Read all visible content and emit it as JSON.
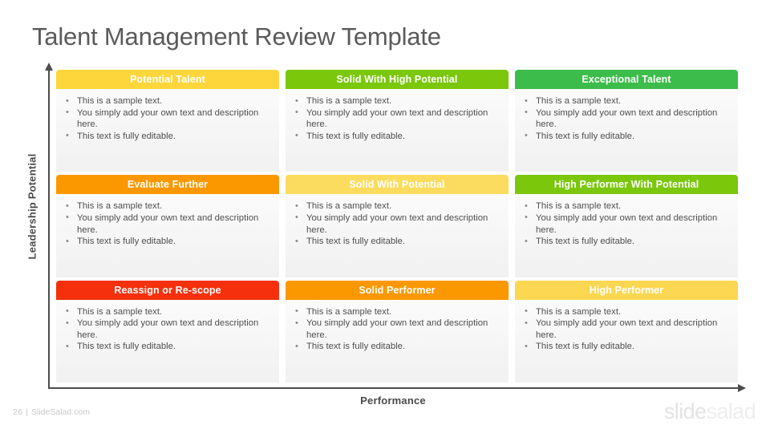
{
  "slide": {
    "title": "Talent Management Review Template"
  },
  "axes": {
    "y_label": "Leadership Potential",
    "x_label": "Performance"
  },
  "bullets": [
    "This is a sample text.",
    "You simply add your own text and description here.",
    "This text is fully editable."
  ],
  "matrix": {
    "cells": [
      {
        "title": "Potential Talent",
        "color": "#fdd63c",
        "row": 1,
        "col": 1
      },
      {
        "title": "Solid With High Potential",
        "color": "#7ac70c",
        "row": 1,
        "col": 2
      },
      {
        "title": "Exceptional Talent",
        "color": "#3cbc4a",
        "row": 1,
        "col": 3
      },
      {
        "title": "Evaluate Further",
        "color": "#fb9800",
        "row": 2,
        "col": 1
      },
      {
        "title": "Solid With Potential",
        "color": "#fcdc5e",
        "row": 2,
        "col": 2
      },
      {
        "title": "High Performer With Potential",
        "color": "#7ac70c",
        "row": 2,
        "col": 3
      },
      {
        "title": "Reassign or Re-scope",
        "color": "#f5300c",
        "row": 3,
        "col": 1
      },
      {
        "title": "Solid Performer",
        "color": "#fb9800",
        "row": 3,
        "col": 2
      },
      {
        "title": "High Performer",
        "color": "#fcd751",
        "row": 3,
        "col": 3
      }
    ]
  },
  "footer": {
    "page_number": "26",
    "separator": "|",
    "site": "SlideSalad.com",
    "brand_first": "slide",
    "brand_second": "salad"
  }
}
